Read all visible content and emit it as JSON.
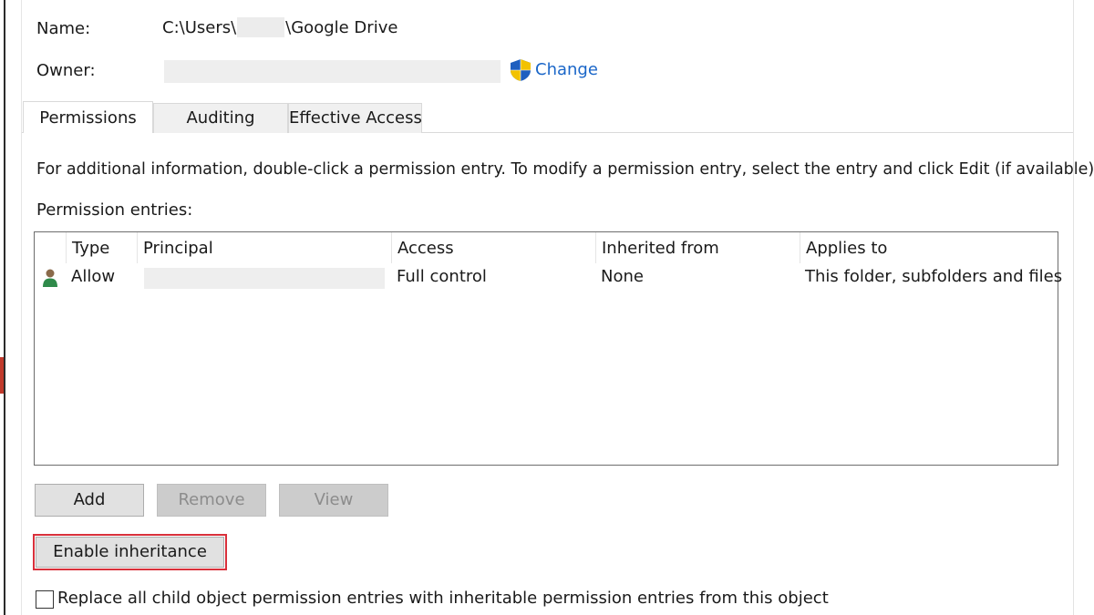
{
  "fields": {
    "name_label": "Name:",
    "name_prefix": "C:\\Users\\",
    "name_suffix": "\\Google Drive",
    "owner_label": "Owner:",
    "change_link": "Change"
  },
  "tabs": [
    {
      "label": "Permissions",
      "active": true
    },
    {
      "label": "Auditing",
      "active": false
    },
    {
      "label": "Effective Access",
      "active": false
    }
  ],
  "info_text": "For additional information, double-click a permission entry. To modify a permission entry, select the entry and click Edit (if available).",
  "entries_label": "Permission entries:",
  "columns": [
    "Type",
    "Principal",
    "Access",
    "Inherited from",
    "Applies to"
  ],
  "entries": [
    {
      "type": "Allow",
      "principal": "",
      "access": "Full control",
      "inherited_from": "None",
      "applies_to": "This folder, subfolders and files"
    }
  ],
  "buttons": {
    "add": "Add",
    "remove": "Remove",
    "view": "View",
    "enable_inheritance": "Enable inheritance"
  },
  "replace_checkbox": {
    "label": "Replace all child object permission entries with inheritable permission entries from this object",
    "checked": false
  },
  "colors": {
    "link": "#1a66c8",
    "highlight_border": "#d9303b",
    "shield_blue": "#1f5fbf",
    "shield_yellow": "#f2c200"
  }
}
